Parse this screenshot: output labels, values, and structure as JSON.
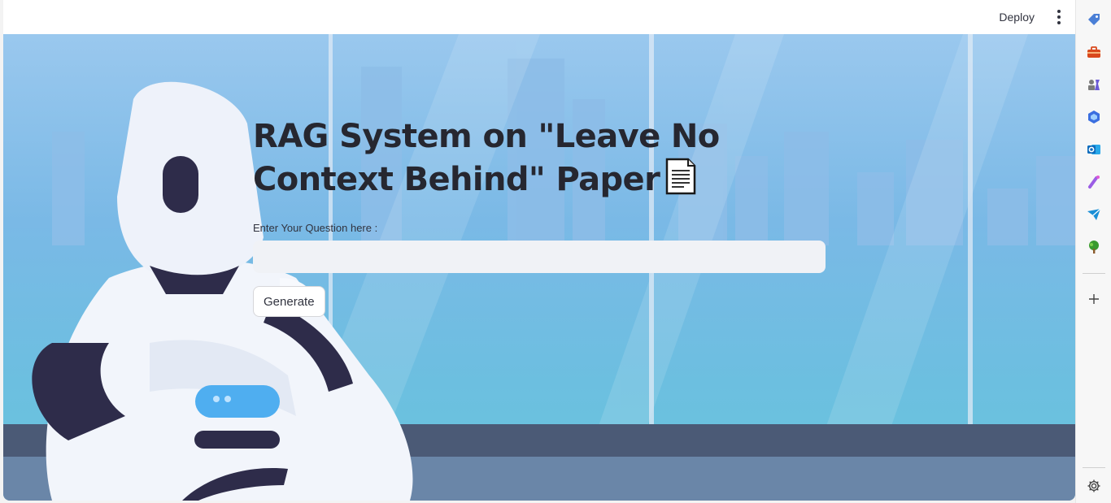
{
  "header": {
    "deploy_label": "Deploy",
    "menu_icon": "kebab-menu-icon"
  },
  "main": {
    "title": "RAG System on \"Leave No Context Behind\" Paper",
    "title_emoji": "document-icon",
    "question_label": "Enter Your Question here :",
    "question_value": "",
    "generate_label": "Generate"
  },
  "sidebar": {
    "items": [
      {
        "icon": "tag-icon",
        "color": "#4a7fd6"
      },
      {
        "icon": "toolbox-icon",
        "color": "#d9481c"
      },
      {
        "icon": "chess-icon",
        "color": "#6b5ad6"
      },
      {
        "icon": "copilot-icon",
        "color": "#3b6fe0"
      },
      {
        "icon": "outlook-icon",
        "color": "#0f6cbd"
      },
      {
        "icon": "magnet-icon",
        "color": "#9b5de5"
      },
      {
        "icon": "send-icon",
        "color": "#1a8fd6"
      },
      {
        "icon": "tree-icon",
        "color": "#3a9a2f"
      }
    ],
    "add_icon": "plus-icon",
    "settings_icon": "gear-icon"
  },
  "colors": {
    "accent": "#31333f",
    "input_bg": "#f0f2f6",
    "sky": "#7ab9e6"
  }
}
